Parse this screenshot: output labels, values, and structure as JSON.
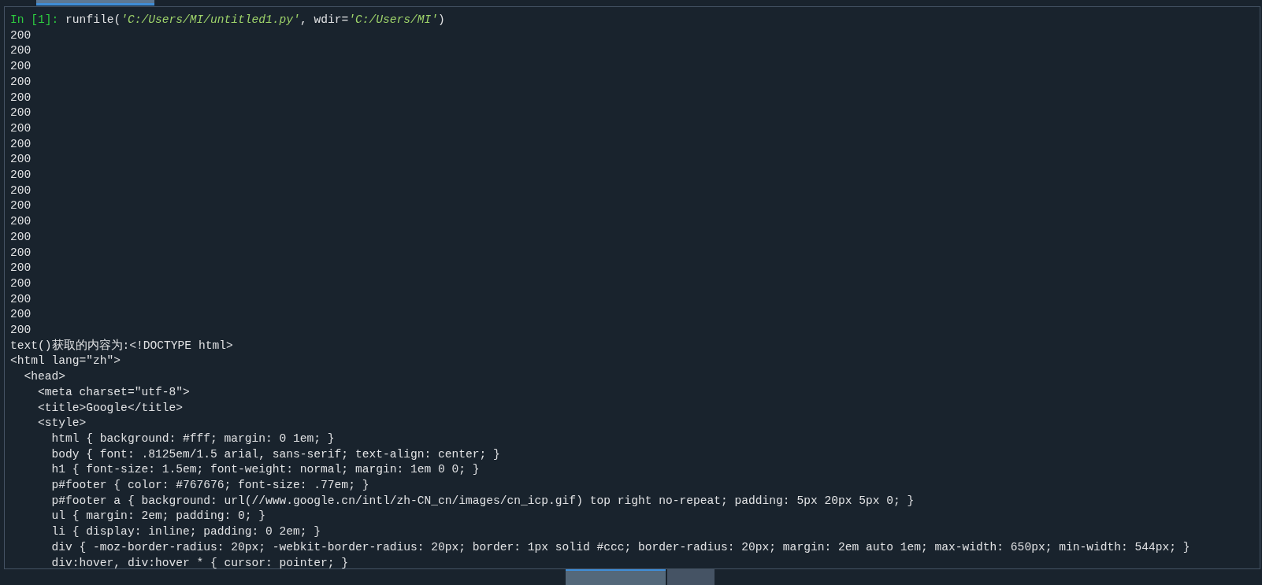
{
  "top_tabs": [
    {
      "selected": true
    }
  ],
  "console": {
    "prompt": "In [1]:",
    "input": [
      {
        "kind": "plain",
        "text": "runfile("
      },
      {
        "kind": "string",
        "text": "'C:/Users/MI/untitled1.py'"
      },
      {
        "kind": "plain",
        "text": ", wdir="
      },
      {
        "kind": "string",
        "text": "'C:/Users/MI'"
      },
      {
        "kind": "plain",
        "text": ")"
      }
    ],
    "output": [
      "200",
      "200",
      "200",
      "200",
      "200",
      "200",
      "200",
      "200",
      "200",
      "200",
      "200",
      "200",
      "200",
      "200",
      "200",
      "200",
      "200",
      "200",
      "200",
      "200",
      "text()获取的内容为:<!DOCTYPE html>",
      "<html lang=\"zh\">",
      "  <head>",
      "    <meta charset=\"utf-8\">",
      "    <title>Google</title>",
      "    <style>",
      "      html { background: #fff; margin: 0 1em; }",
      "      body { font: .8125em/1.5 arial, sans-serif; text-align: center; }",
      "      h1 { font-size: 1.5em; font-weight: normal; margin: 1em 0 0; }",
      "      p#footer { color: #767676; font-size: .77em; }",
      "      p#footer a { background: url(//www.google.cn/intl/zh-CN_cn/images/cn_icp.gif) top right no-repeat; padding: 5px 20px 5px 0; }",
      "      ul { margin: 2em; padding: 0; }",
      "      li { display: inline; padding: 0 2em; }",
      "      div { -moz-border-radius: 20px; -webkit-border-radius: 20px; border: 1px solid #ccc; border-radius: 20px; margin: 2em auto 1em; max-width: 650px; min-width: 544px; }",
      "      div:hover, div:hover * { cursor: pointer; }"
    ]
  },
  "bottom_tabs": [
    {
      "selected": true
    },
    {
      "selected": false
    }
  ]
}
